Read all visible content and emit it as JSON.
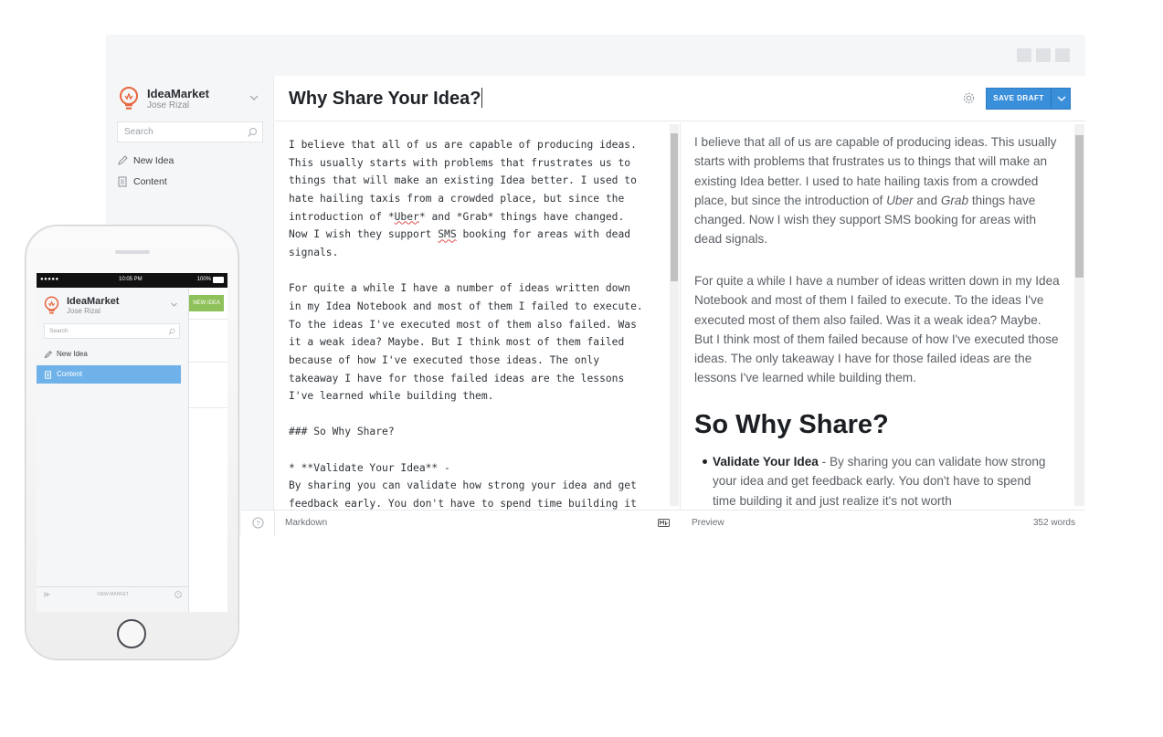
{
  "app": {
    "name": "IdeaMarket",
    "user": "Jose Rizal"
  },
  "sidebar": {
    "search_placeholder": "Search",
    "items": [
      {
        "label": "New Idea",
        "icon": "pencil-icon"
      },
      {
        "label": "Content",
        "icon": "document-icon"
      }
    ]
  },
  "editor": {
    "title": "Why Share Your Idea?",
    "save_label": "SAVE DRAFT",
    "markdown_lines": [
      "I believe that all of us are capable of producing ideas.",
      "This usually starts with problems that frustrates us to",
      "things that will make an existing Idea better. I used to",
      "hate hailing taxis from a crowded place, but since the",
      "introduction of *Uber* and *Grab* things have changed.",
      "Now I wish they support SMS booking for areas with dead",
      "signals.",
      "",
      "For quite a while I have a number of ideas written down",
      "in my Idea Notebook and most of them I failed to execute.",
      "To the ideas I've executed most of them also failed. Was",
      "it a weak idea? Maybe. But I think most of them failed",
      "because of how I've executed those ideas. The only",
      "takeaway I have for those failed ideas are the lessons",
      "I've learned while building them.",
      "",
      "### So Why Share?",
      "",
      "* **Validate Your Idea** -",
      "By sharing you can validate how strong your idea and get",
      "feedback early. You don't have to spend time building it"
    ],
    "preview_p1": "I believe that all of us are capable of producing ideas. This usually starts with problems that frustrates us to things that will make an existing Idea better. I used to hate hailing taxis from a crowded place, but since the introduction of",
    "preview_p1_uber": "Uber",
    "preview_p1_and": "and",
    "preview_p1_grab": "Grab",
    "preview_p1_end": "things have changed. Now I wish they support SMS booking for areas with dead signals.",
    "preview_p2": "For quite a while I have a number of ideas written down in my Idea Notebook and most of them I failed to execute. To the ideas I've executed most of them also failed. Was it a weak idea? Maybe. But I think most of them failed because of how I've executed those ideas. The only takeaway I have for those failed ideas are the lessons I've learned while building them.",
    "preview_heading": "So Why Share?",
    "preview_li_bold": "Validate Your Idea",
    "preview_li_text": "- By sharing you can validate how strong your idea and get feedback early. You don't have to spend time building it and just realize it's not worth"
  },
  "footer": {
    "markdown_label": "Markdown",
    "preview_label": "Preview",
    "word_count": "352 words"
  },
  "phone": {
    "status_time": "10:05 PM",
    "status_signal": "●●●●● ",
    "status_battery": "100%",
    "new_idea_button": "NEW IDEA",
    "view_market": "VIEW MARKET"
  },
  "colors": {
    "accent": "#3a8fdb",
    "brand_orange": "#e8663d",
    "active_nav": "#6fb2ea",
    "new_idea_green": "#8fc15a"
  }
}
